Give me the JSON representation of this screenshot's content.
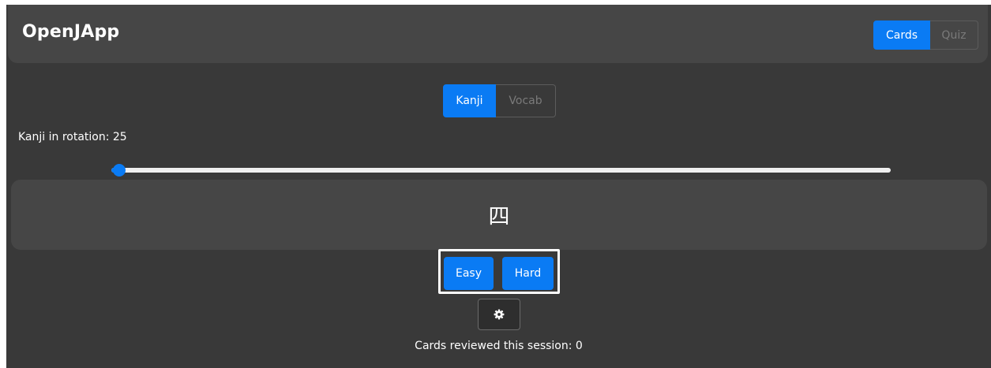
{
  "app": {
    "title": "OpenJApp"
  },
  "mode_tabs": [
    {
      "label": "Cards",
      "active": true
    },
    {
      "label": "Quiz",
      "active": false
    }
  ],
  "type_tabs": [
    {
      "label": "Kanji",
      "active": true
    },
    {
      "label": "Vocab",
      "active": false
    }
  ],
  "rotation": {
    "label": "Kanji in rotation: 25",
    "value": 25,
    "slider_fraction": 0.01
  },
  "card": {
    "character": "四"
  },
  "rating": {
    "easy_label": "Easy",
    "hard_label": "Hard"
  },
  "settings": {
    "icon": "gear-icon"
  },
  "session": {
    "reviewed_text": "Cards reviewed this session: 0"
  },
  "colors": {
    "accent": "#0a7bf4",
    "background": "#393939",
    "panel": "#464646"
  }
}
